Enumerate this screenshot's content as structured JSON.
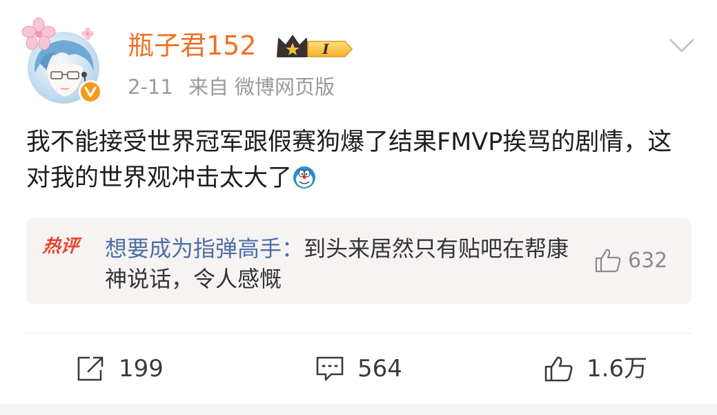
{
  "user": {
    "name": "瓶子君152",
    "level": "I",
    "verified": true
  },
  "meta": {
    "date": "2-11",
    "source": "来自 微博网页版"
  },
  "post": {
    "text": "我不能接受世界冠军跟假赛狗爆了结果FMVP挨骂的剧情，这对我的世界观冲击太大了",
    "emoji": "doraemon-emoji"
  },
  "hot_comment": {
    "label": "热评",
    "user": "想要成为指弹高手",
    "separator": "：",
    "text": "到头来居然只有贴吧在帮康神说话，令人感慨",
    "likes": "632"
  },
  "actions": {
    "repost": "199",
    "comment": "564",
    "like": "1.6万"
  },
  "colors": {
    "username": "#f06f26",
    "hot_label": "#e8432e",
    "hot_user": "#4b6fa8",
    "verified_badge": "#f39a1f"
  }
}
